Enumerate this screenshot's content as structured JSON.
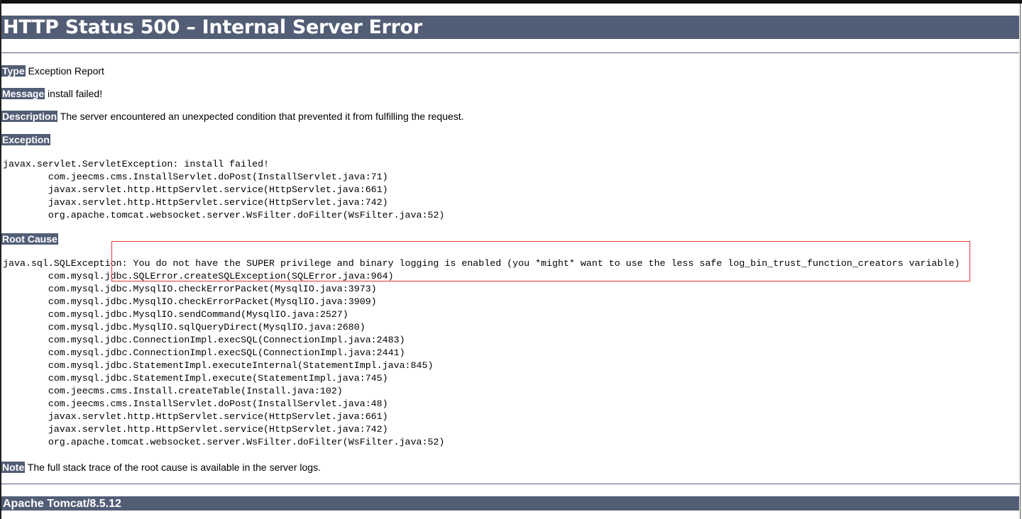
{
  "title": "HTTP Status 500 – Internal Server Error",
  "type": {
    "label": "Type",
    "value": "Exception Report"
  },
  "message": {
    "label": "Message",
    "value": "install failed!"
  },
  "description": {
    "label": "Description",
    "value": "The server encountered an unexpected condition that prevented it from fulfilling the request."
  },
  "exception": {
    "label": "Exception",
    "trace": "javax.servlet.ServletException: install failed!\n\tcom.jeecms.cms.InstallServlet.doPost(InstallServlet.java:71)\n\tjavax.servlet.http.HttpServlet.service(HttpServlet.java:661)\n\tjavax.servlet.http.HttpServlet.service(HttpServlet.java:742)\n\torg.apache.tomcat.websocket.server.WsFilter.doFilter(WsFilter.java:52)"
  },
  "root_cause": {
    "label": "Root Cause",
    "trace": "java.sql.SQLException: You do not have the SUPER privilege and binary logging is enabled (you *might* want to use the less safe log_bin_trust_function_creators variable)\n\tcom.mysql.jdbc.SQLError.createSQLException(SQLError.java:964)\n\tcom.mysql.jdbc.MysqlIO.checkErrorPacket(MysqlIO.java:3973)\n\tcom.mysql.jdbc.MysqlIO.checkErrorPacket(MysqlIO.java:3909)\n\tcom.mysql.jdbc.MysqlIO.sendCommand(MysqlIO.java:2527)\n\tcom.mysql.jdbc.MysqlIO.sqlQueryDirect(MysqlIO.java:2680)\n\tcom.mysql.jdbc.ConnectionImpl.execSQL(ConnectionImpl.java:2483)\n\tcom.mysql.jdbc.ConnectionImpl.execSQL(ConnectionImpl.java:2441)\n\tcom.mysql.jdbc.StatementImpl.executeInternal(StatementImpl.java:845)\n\tcom.mysql.jdbc.StatementImpl.execute(StatementImpl.java:745)\n\tcom.jeecms.cms.Install.createTable(Install.java:102)\n\tcom.jeecms.cms.InstallServlet.doPost(InstallServlet.java:48)\n\tjavax.servlet.http.HttpServlet.service(HttpServlet.java:661)\n\tjavax.servlet.http.HttpServlet.service(HttpServlet.java:742)\n\torg.apache.tomcat.websocket.server.WsFilter.doFilter(WsFilter.java:52)"
  },
  "note": {
    "label": "Note",
    "value": "The full stack trace of the root cause is available in the server logs."
  },
  "footer": "Apache Tomcat/8.5.12",
  "colors": {
    "header_bg": "#525D76",
    "highlight": "#e53935"
  }
}
